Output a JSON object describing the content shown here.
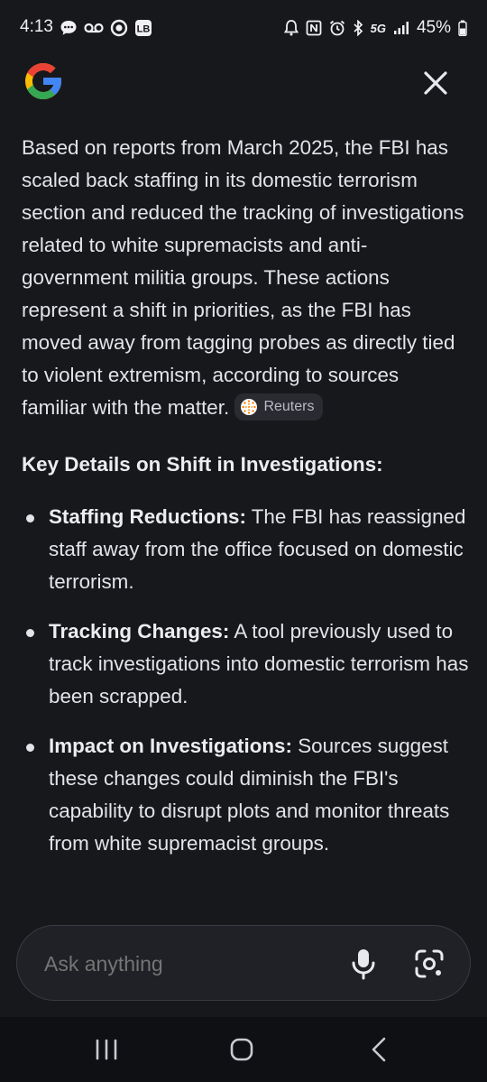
{
  "status_bar": {
    "time": "4:13",
    "network": "5G",
    "battery": "45%",
    "icons": [
      "chat-bubble-icon",
      "voicemail-icon",
      "record-icon",
      "lb-app-icon",
      "alarm-icon",
      "nfc-icon",
      "alarm-clock-icon",
      "bluetooth-icon",
      "signal-icon",
      "battery-icon"
    ]
  },
  "header": {
    "logo": "google-g-logo",
    "close_icon": "close-icon"
  },
  "answer": {
    "paragraph": "Based on reports from March 2025, the FBI has scaled back staffing in its domestic terrorism section and reduced the tracking of investigations related to white supremacists and anti-government militia groups. These actions represent a shift in priorities, as the FBI has moved away from tagging probes as directly tied to violent extremism, according to sources familiar with the matter.",
    "source_chip": "Reuters",
    "heading": "Key Details on Shift in Investigations:",
    "bullets": [
      {
        "title": "Staffing Reductions:",
        "text": "The FBI has reassigned staff away from the office focused on domestic terrorism."
      },
      {
        "title": "Tracking Changes:",
        "text": "A tool previously used to track investigations into domestic terrorism has been scrapped."
      },
      {
        "title": "Impact on Investigations:",
        "text": "Sources suggest these changes could diminish the FBI's capability to disrupt plots and monitor threats from white supremacist groups."
      }
    ]
  },
  "ask_bar": {
    "placeholder": "Ask anything"
  },
  "colors": {
    "background": "#17181c",
    "text": "#e3e4e9",
    "google_blue": "#4285F4",
    "google_red": "#EA4335",
    "google_yellow": "#FBBC05",
    "google_green": "#34A853",
    "reuters_orange": "#ff8000"
  }
}
